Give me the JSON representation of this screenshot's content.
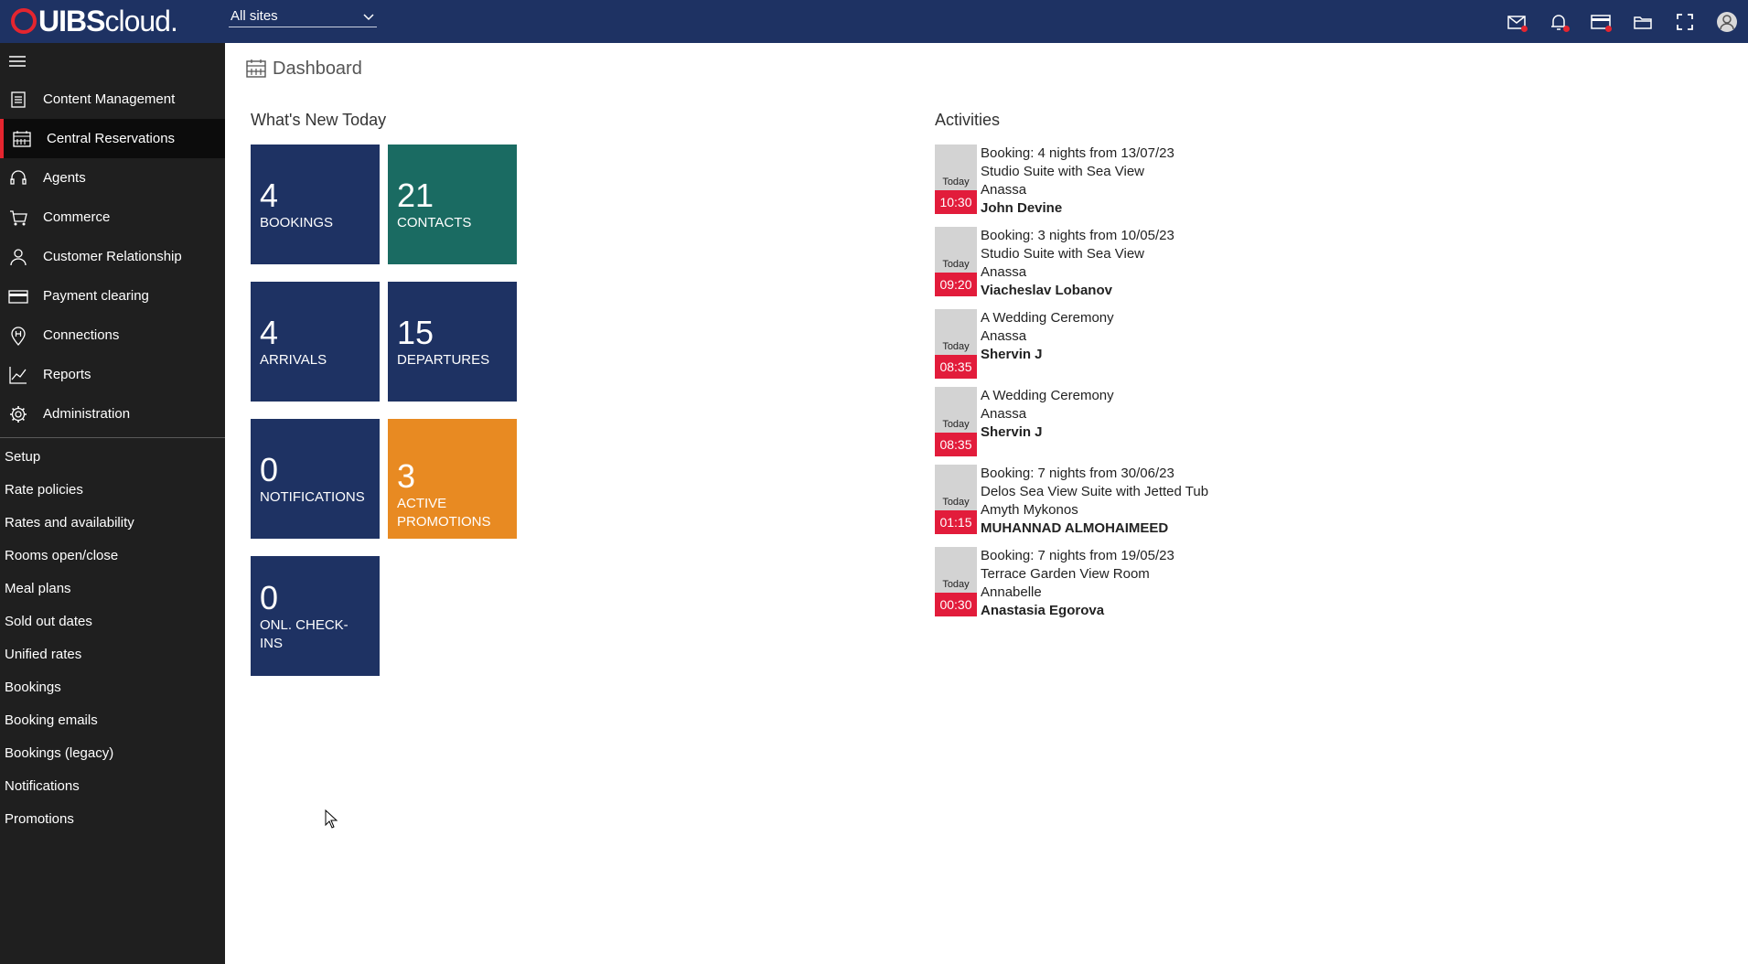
{
  "header": {
    "logo_text_bold": "UIBS",
    "logo_text_light": "cloud.",
    "site_select_value": "All sites",
    "icons": [
      "mail-icon",
      "bell-icon",
      "card-icon",
      "folder-icon",
      "fullscreen-icon",
      "user-avatar-icon"
    ],
    "colors": {
      "bar": "#1e3263",
      "accent": "#e4252f"
    }
  },
  "sidebar": {
    "items": [
      {
        "label": "Content Management",
        "icon": "document-icon"
      },
      {
        "label": "Central Reservations",
        "icon": "calendar-icon",
        "active": true
      },
      {
        "label": "Agents",
        "icon": "headset-icon"
      },
      {
        "label": "Commerce",
        "icon": "cart-icon"
      },
      {
        "label": "Customer Relationship",
        "icon": "person-icon"
      },
      {
        "label": "Payment clearing",
        "icon": "card-icon"
      },
      {
        "label": "Connections",
        "icon": "hotel-pin-icon"
      },
      {
        "label": "Reports",
        "icon": "chart-icon"
      },
      {
        "label": "Administration",
        "icon": "gear-icon"
      }
    ],
    "sub_items": [
      "Setup",
      "Rate policies",
      "Rates and availability",
      "Rooms open/close",
      "Meal plans",
      "Sold out dates",
      "Unified rates",
      "Bookings",
      "Booking emails",
      "Bookings (legacy)",
      "Notifications",
      "Promotions"
    ]
  },
  "main": {
    "title": "Dashboard",
    "whats_new_heading": "What's New Today",
    "activities_heading": "Activities",
    "tiles": [
      {
        "value": "4",
        "label": "BOOKINGS",
        "color": "#1e3263"
      },
      {
        "value": "21",
        "label": "CONTACTS",
        "color": "#1a6b62"
      },
      {
        "value": "4",
        "label": "ARRIVALS",
        "color": "#1e3263"
      },
      {
        "value": "15",
        "label": "DEPARTURES",
        "color": "#1e3263"
      },
      {
        "value": "0",
        "label": "NOTIFICATIONS",
        "color": "#1e3263"
      },
      {
        "value": "3",
        "label": "ACTIVE PROMOTIONS",
        "color": "#e88a22"
      },
      {
        "value": "0",
        "label": "ONL. CHECK-INS",
        "color": "#1e3263"
      }
    ],
    "activities": [
      {
        "day": "Today",
        "time": "10:30",
        "lines": [
          "Booking: 4 nights from 13/07/23",
          "Studio Suite with Sea View",
          "Anassa"
        ],
        "name": "John Devine"
      },
      {
        "day": "Today",
        "time": "09:20",
        "lines": [
          "Booking: 3 nights from 10/05/23",
          "Studio Suite with Sea View",
          "Anassa"
        ],
        "name": "Viacheslav Lobanov"
      },
      {
        "day": "Today",
        "time": "08:35",
        "lines": [
          "A Wedding Ceremony",
          "Anassa"
        ],
        "name": "Shervin J"
      },
      {
        "day": "Today",
        "time": "08:35",
        "lines": [
          "A Wedding Ceremony",
          "Anassa"
        ],
        "name": "Shervin J"
      },
      {
        "day": "Today",
        "time": "01:15",
        "lines": [
          "Booking: 7 nights from 30/06/23",
          "Delos Sea View Suite with Jetted Tub",
          "Amyth Mykonos"
        ],
        "name": "MUHANNAD ALMOHAIMEED"
      },
      {
        "day": "Today",
        "time": "00:30",
        "lines": [
          "Booking: 7 nights from 19/05/23",
          "Terrace Garden View Room",
          "Annabelle"
        ],
        "name": "Anastasia Egorova"
      }
    ]
  }
}
